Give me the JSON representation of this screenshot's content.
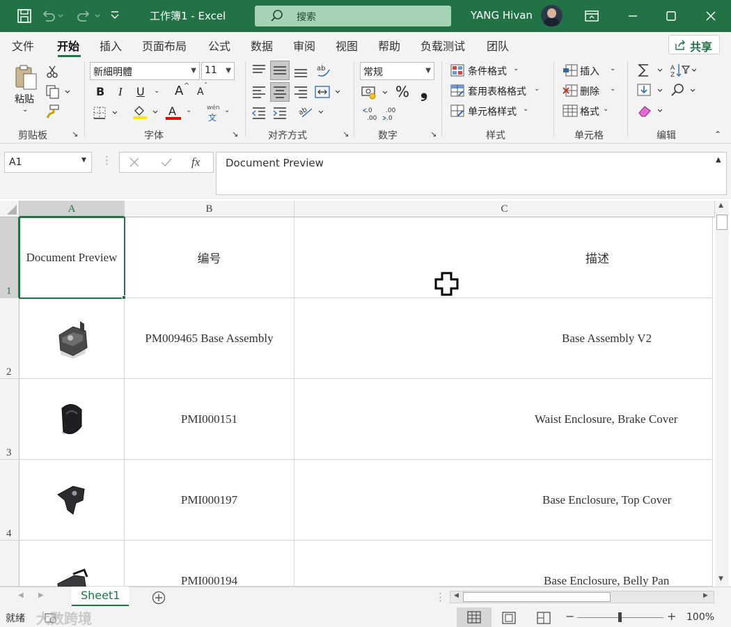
{
  "titlebar": {
    "title": "工作簿1  -  Excel",
    "search_placeholder": "搜索",
    "user_name": "YANG Hivan",
    "accent": "#217346"
  },
  "menu": {
    "items": [
      "文件",
      "开始",
      "插入",
      "页面布局",
      "公式",
      "数据",
      "审阅",
      "视图",
      "帮助",
      "负载测试",
      "团队"
    ],
    "share": "共享"
  },
  "ribbon": {
    "groups": {
      "clipboard": "剪贴板",
      "font": "字体",
      "alignment": "对齐方式",
      "number": "数字",
      "styles": "样式",
      "cells": "单元格",
      "editing": "编辑"
    },
    "paste": "粘贴",
    "font_name": "新細明體",
    "font_size": "11",
    "bold": "B",
    "italic": "I",
    "underline": "U",
    "grow_font": "A",
    "shrink_font": "A",
    "font_color": "A",
    "phonetic_top": "wén",
    "phonetic_bottom": "文",
    "number_format": "常规",
    "percent": "%",
    "comma": "❟",
    "inc_decimal": ".00",
    "dec_decimal": ".00",
    "conditional_format": "条件格式",
    "format_as_table": "套用表格格式",
    "cell_styles": "单元格样式",
    "insert": "插入",
    "delete": "删除",
    "format": "格式"
  },
  "formula_bar": {
    "name_box": "A1",
    "fx": "fx",
    "content": "Document Preview"
  },
  "grid": {
    "columns": [
      "A",
      "B",
      "C"
    ],
    "rows": [
      {
        "num": "1",
        "a": "Document Preview",
        "b": "编号",
        "c": "描述"
      },
      {
        "num": "2",
        "a": "",
        "b": "PM009465 Base Assembly",
        "c": "Base Assembly V2"
      },
      {
        "num": "3",
        "a": "",
        "b": "PMI000151",
        "c": "Waist Enclosure, Brake Cover"
      },
      {
        "num": "4",
        "a": "",
        "b": "PMI000197",
        "c": "Base Enclosure, Top Cover"
      },
      {
        "num": "",
        "a": "",
        "b": "PMI000194",
        "c": "Base Enclosure, Belly Pan"
      }
    ]
  },
  "sheets": [
    "Sheet1"
  ],
  "status": {
    "ready": "就绪",
    "zoom": "100%",
    "zoom_minus": "−",
    "zoom_plus": "+",
    "watermark": "大数跨境"
  }
}
